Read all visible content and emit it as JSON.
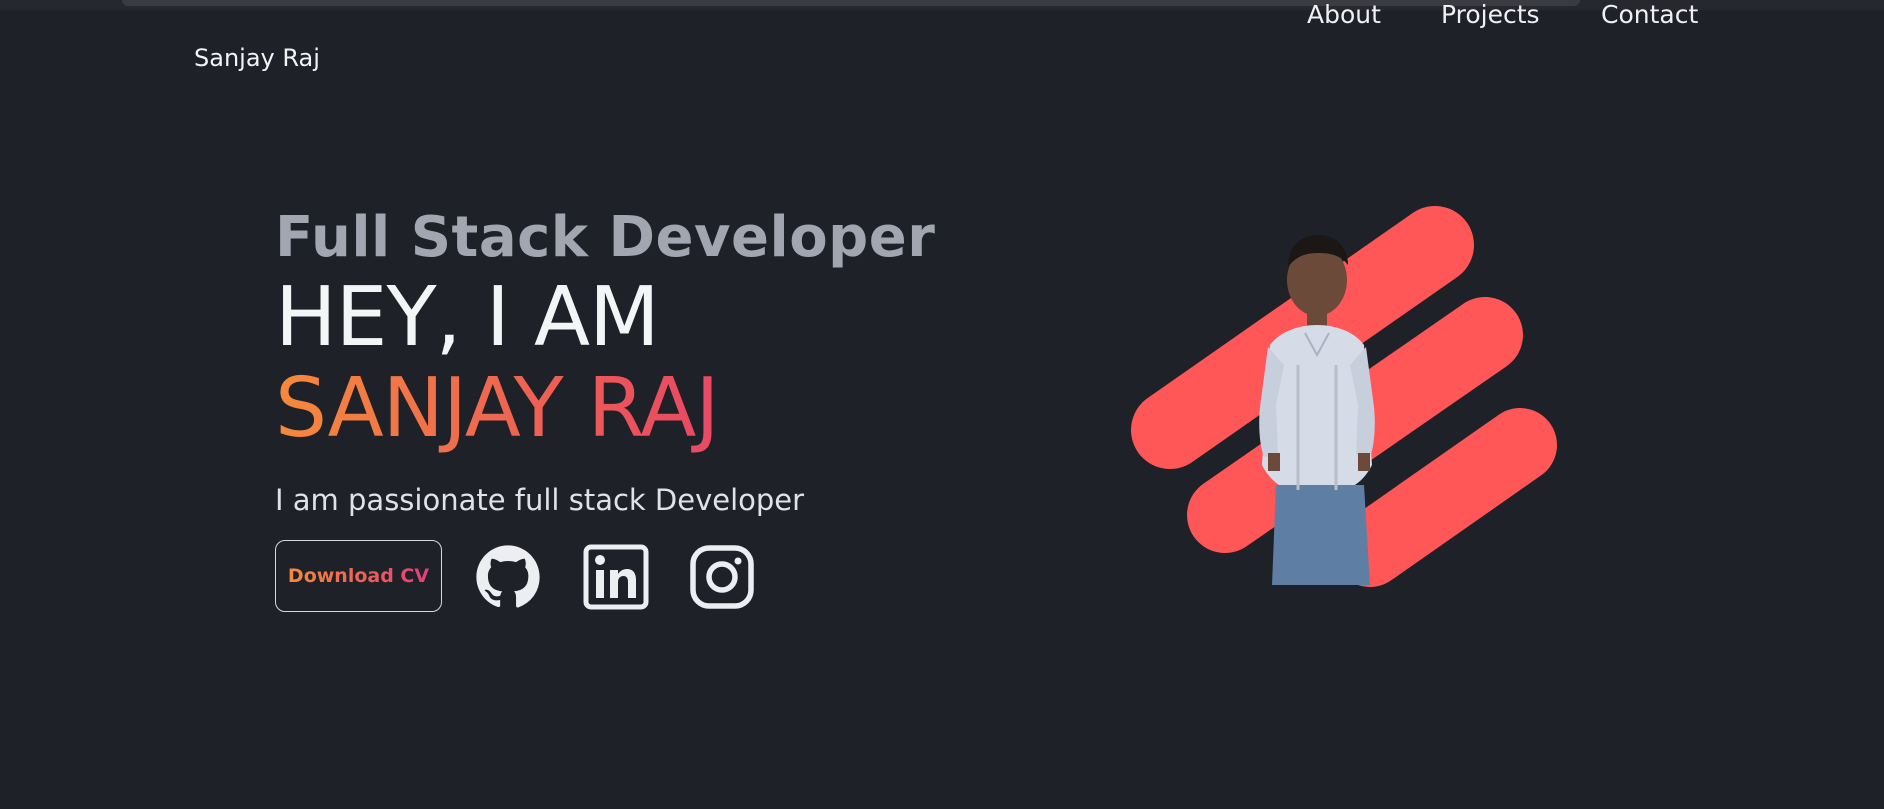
{
  "nav": {
    "brand": "Sanjay Raj",
    "links": [
      {
        "label": "About"
      },
      {
        "label": "Projects"
      },
      {
        "label": "Contact"
      }
    ]
  },
  "hero": {
    "role": "Full Stack Developer",
    "greeting": "HEY, I AM",
    "name": "SANJAY RAJ",
    "tagline": "I am passionate full stack Developer",
    "cv_button": "Download CV",
    "social_icons": [
      "github-icon",
      "linkedin-icon",
      "instagram-icon"
    ]
  },
  "colors": {
    "background": "#1e2128",
    "accent_orange": "#f5893c",
    "accent_pink": "#e03b7a",
    "stripes": "#ff5757"
  }
}
